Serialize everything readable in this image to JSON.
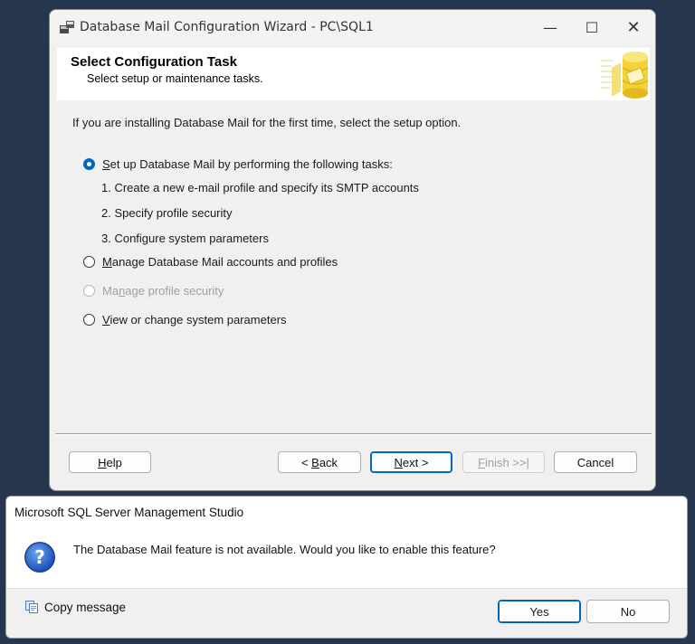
{
  "wizard": {
    "title": "Database Mail Configuration Wizard - PC\\SQL1",
    "caption": {
      "minimize": "—",
      "maximize": "☐",
      "close": "✕"
    },
    "header": {
      "title": "Select Configuration Task",
      "subtitle": "Select setup or maintenance tasks."
    },
    "intro": "If you are installing Database Mail for the first time, select the setup option.",
    "options": [
      {
        "label_pre": "",
        "label_access": "S",
        "label_post": "et up Database Mail by performing the following tasks:",
        "checked": true,
        "enabled": true
      },
      {
        "label_pre": "",
        "label_access": "M",
        "label_post": "anage Database Mail accounts and profiles",
        "checked": false,
        "enabled": true
      },
      {
        "label_pre": "Ma",
        "label_access": "n",
        "label_post": "age profile security",
        "checked": false,
        "enabled": false
      },
      {
        "label_pre": "",
        "label_access": "V",
        "label_post": "iew or change system parameters",
        "checked": false,
        "enabled": true
      }
    ],
    "tasks": [
      "1. Create a new e-mail profile and specify its SMTP accounts",
      "2. Specify profile security",
      "3. Configure system parameters"
    ],
    "buttons": {
      "help": {
        "pre": "",
        "access": "H",
        "post": "elp"
      },
      "back": {
        "pre": "< ",
        "access": "B",
        "post": "ack"
      },
      "next": {
        "pre": "",
        "access": "N",
        "post": "ext >"
      },
      "finish": {
        "pre": "",
        "access": "F",
        "post": "inish >>|"
      },
      "cancel": "Cancel"
    }
  },
  "messagebox": {
    "title": "Microsoft SQL Server Management Studio",
    "text": "The Database Mail feature is not available.  Would you like to enable this feature?",
    "copy_label": "Copy message",
    "yes": "Yes",
    "no": "No"
  },
  "colors": {
    "accent": "#0067c0",
    "desktop": "#26364f"
  }
}
